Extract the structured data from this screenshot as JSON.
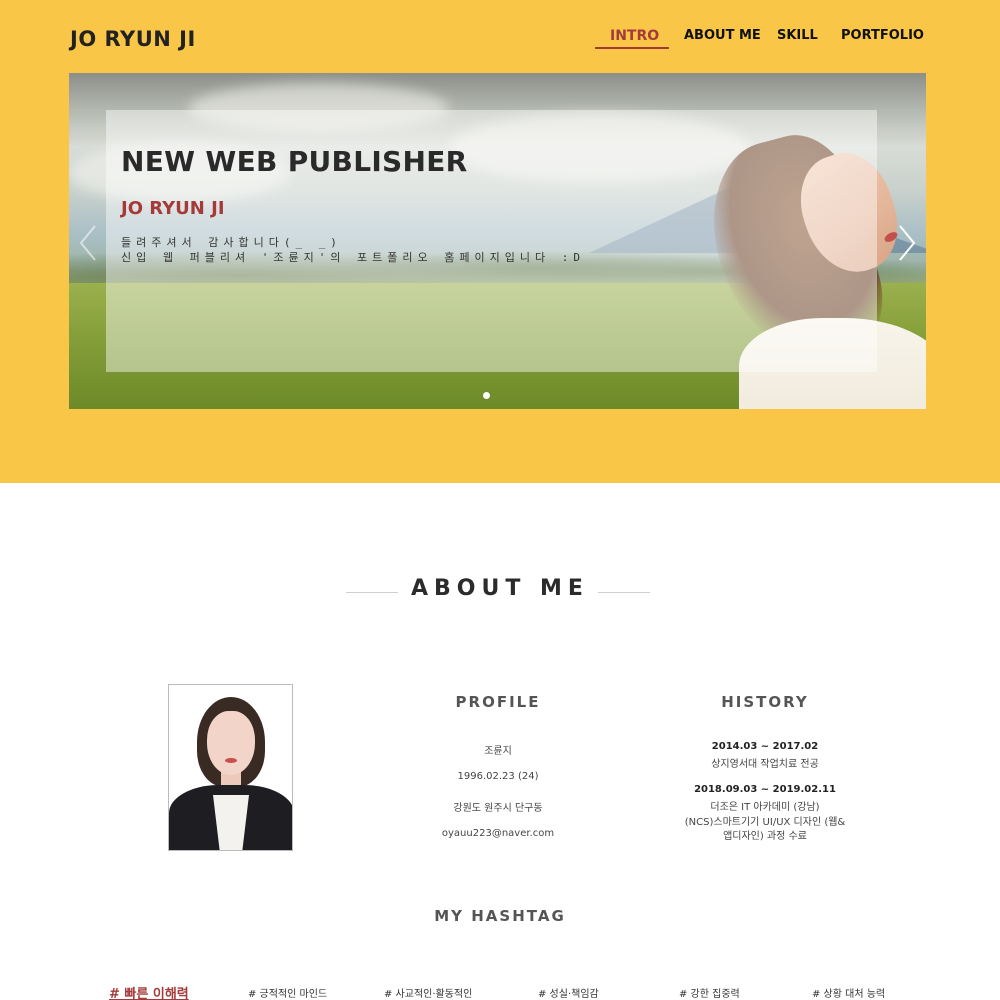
{
  "header": {
    "logo": "JO RYUN JI",
    "nav": [
      {
        "label": "INTRO",
        "active": true
      },
      {
        "label": "ABOUT ME",
        "active": false
      },
      {
        "label": "SKILL",
        "active": false
      },
      {
        "label": "PORTFOLIO",
        "active": false
      }
    ]
  },
  "hero": {
    "title": "NEW WEB PUBLISHER",
    "subtitle": "JO RYUN JI",
    "line1": "들려주셔서 감사합니다(_ _)",
    "line2": "신입 웹 퍼블리셔 '조륜지'의 포트폴리오 홈페이지입니다 :D",
    "prev_icon": "chevron-left-icon",
    "next_icon": "chevron-right-icon",
    "slide_count": 1
  },
  "about": {
    "title": "ABOUT ME",
    "profile": {
      "title": "PROFILE",
      "lines": [
        "조륜지",
        "1996.02.23 (24)",
        "강원도 원주시 단구동",
        "oyauu223@naver.com"
      ]
    },
    "history": {
      "title": "HISTORY",
      "items": [
        {
          "date": "2014.03 ~ 2017.02",
          "desc": [
            "상지영서대 작업치료 전공"
          ]
        },
        {
          "date": "2018.09.03 ~ 2019.02.11",
          "desc": [
            "더조은 IT 아카데미 (강남)",
            "(NCS)스마트기기 UI/UX 디자인 (웹&",
            "앱디자인) 과정 수료"
          ]
        }
      ]
    },
    "hashtag": {
      "title": "MY HASHTAG",
      "tags": [
        "# 빠른 이해력",
        "# 긍적적인 마인드",
        "# 사교적인·활동적인",
        "# 성실·책임감",
        "# 강한 집중력",
        "# 상황 대처 능력"
      ]
    }
  },
  "colors": {
    "brand_yellow": "#fac648",
    "accent_red": "#a53a3a"
  }
}
